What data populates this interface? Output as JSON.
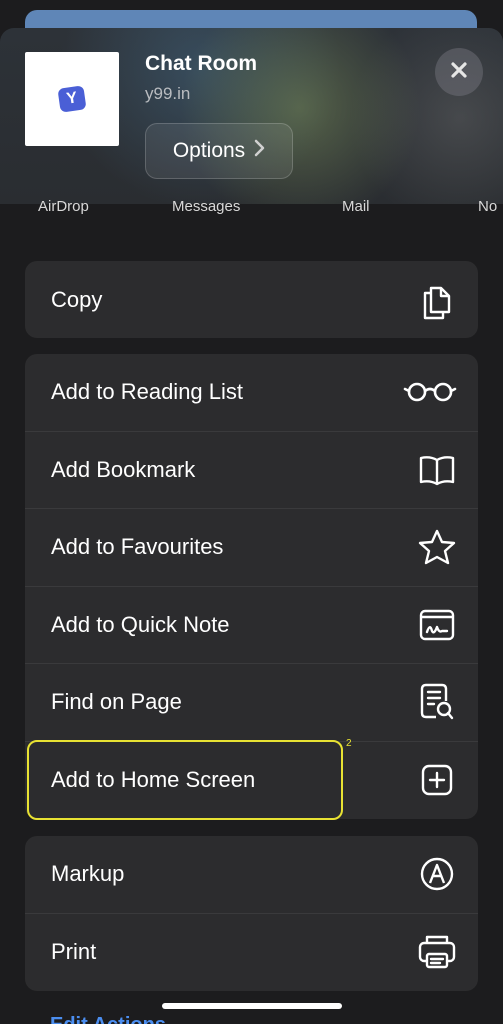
{
  "header": {
    "title": "Chat Room",
    "subtitle": "y99.in",
    "options_label": "Options",
    "app_icon_text": "Y"
  },
  "share_targets": [
    "AirDrop",
    "Messages",
    "Mail",
    "No"
  ],
  "groups": [
    {
      "rows": [
        {
          "label": "Copy",
          "icon": "copy-icon"
        }
      ]
    },
    {
      "rows": [
        {
          "label": "Add to Reading List",
          "icon": "glasses-icon"
        },
        {
          "label": "Add Bookmark",
          "icon": "book-icon"
        },
        {
          "label": "Add to Favourites",
          "icon": "star-icon"
        },
        {
          "label": "Add to Quick Note",
          "icon": "quick-note-icon"
        },
        {
          "label": "Find on Page",
          "icon": "find-in-page-icon"
        },
        {
          "label": "Add to Home Screen",
          "icon": "plus-square-icon"
        }
      ]
    },
    {
      "rows": [
        {
          "label": "Markup",
          "icon": "markup-icon"
        },
        {
          "label": "Print",
          "icon": "printer-icon"
        }
      ]
    }
  ],
  "highlight_number": "2",
  "edit_actions": "Edit Actions"
}
